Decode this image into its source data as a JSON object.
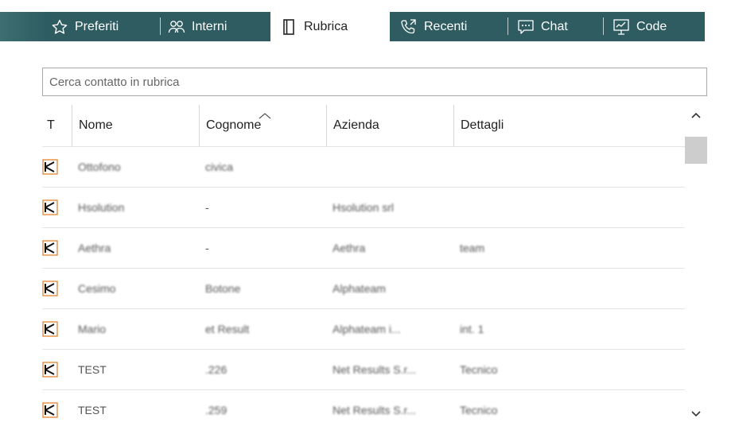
{
  "tabs": [
    {
      "label": "Preferiti",
      "icon": "star-icon",
      "active": false
    },
    {
      "label": "Interni",
      "icon": "users-icon",
      "active": false
    },
    {
      "label": "Rubrica",
      "icon": "book-icon",
      "active": true
    },
    {
      "label": "Recenti",
      "icon": "phone-recent-icon",
      "active": false
    },
    {
      "label": "Chat",
      "icon": "chat-icon",
      "active": false
    },
    {
      "label": "Code",
      "icon": "queue-icon",
      "active": false
    }
  ],
  "search": {
    "placeholder": "Cerca contatto in rubrica",
    "value": ""
  },
  "table": {
    "columns": [
      "T",
      "Nome",
      "Cognome",
      "Azienda",
      "Dettagli"
    ],
    "sorted_column": "Cognome",
    "rows": [
      {
        "type_icon": "contact-card-icon",
        "nome": "Ottofono",
        "cognome": "civica",
        "azienda": "",
        "dettagli": ""
      },
      {
        "type_icon": "contact-card-icon",
        "nome": "Hsolution",
        "cognome": "-",
        "azienda": "Hsolution srl",
        "dettagli": ""
      },
      {
        "type_icon": "contact-card-icon",
        "nome": "Aethra",
        "cognome": "-",
        "azienda": "Aethra",
        "dettagli": "team"
      },
      {
        "type_icon": "contact-card-icon",
        "nome": "Cesimo",
        "cognome": "Botone",
        "azienda": "Alphateam",
        "dettagli": ""
      },
      {
        "type_icon": "contact-card-icon",
        "nome": "Mario",
        "cognome": "et Result",
        "azienda": "Alphateam i...",
        "dettagli": "int. 1"
      },
      {
        "type_icon": "contact-card-icon",
        "nome": "TEST",
        "cognome": ".226",
        "azienda": "Net Results S.r...",
        "dettagli": "Tecnico"
      },
      {
        "type_icon": "contact-card-icon",
        "nome": "TEST",
        "cognome": ".259",
        "azienda": "Net Results S.r...",
        "dettagli": "Tecnico"
      }
    ]
  },
  "colors": {
    "tabbar": "#2e5c61",
    "icon_accent": "#e07a1f"
  }
}
